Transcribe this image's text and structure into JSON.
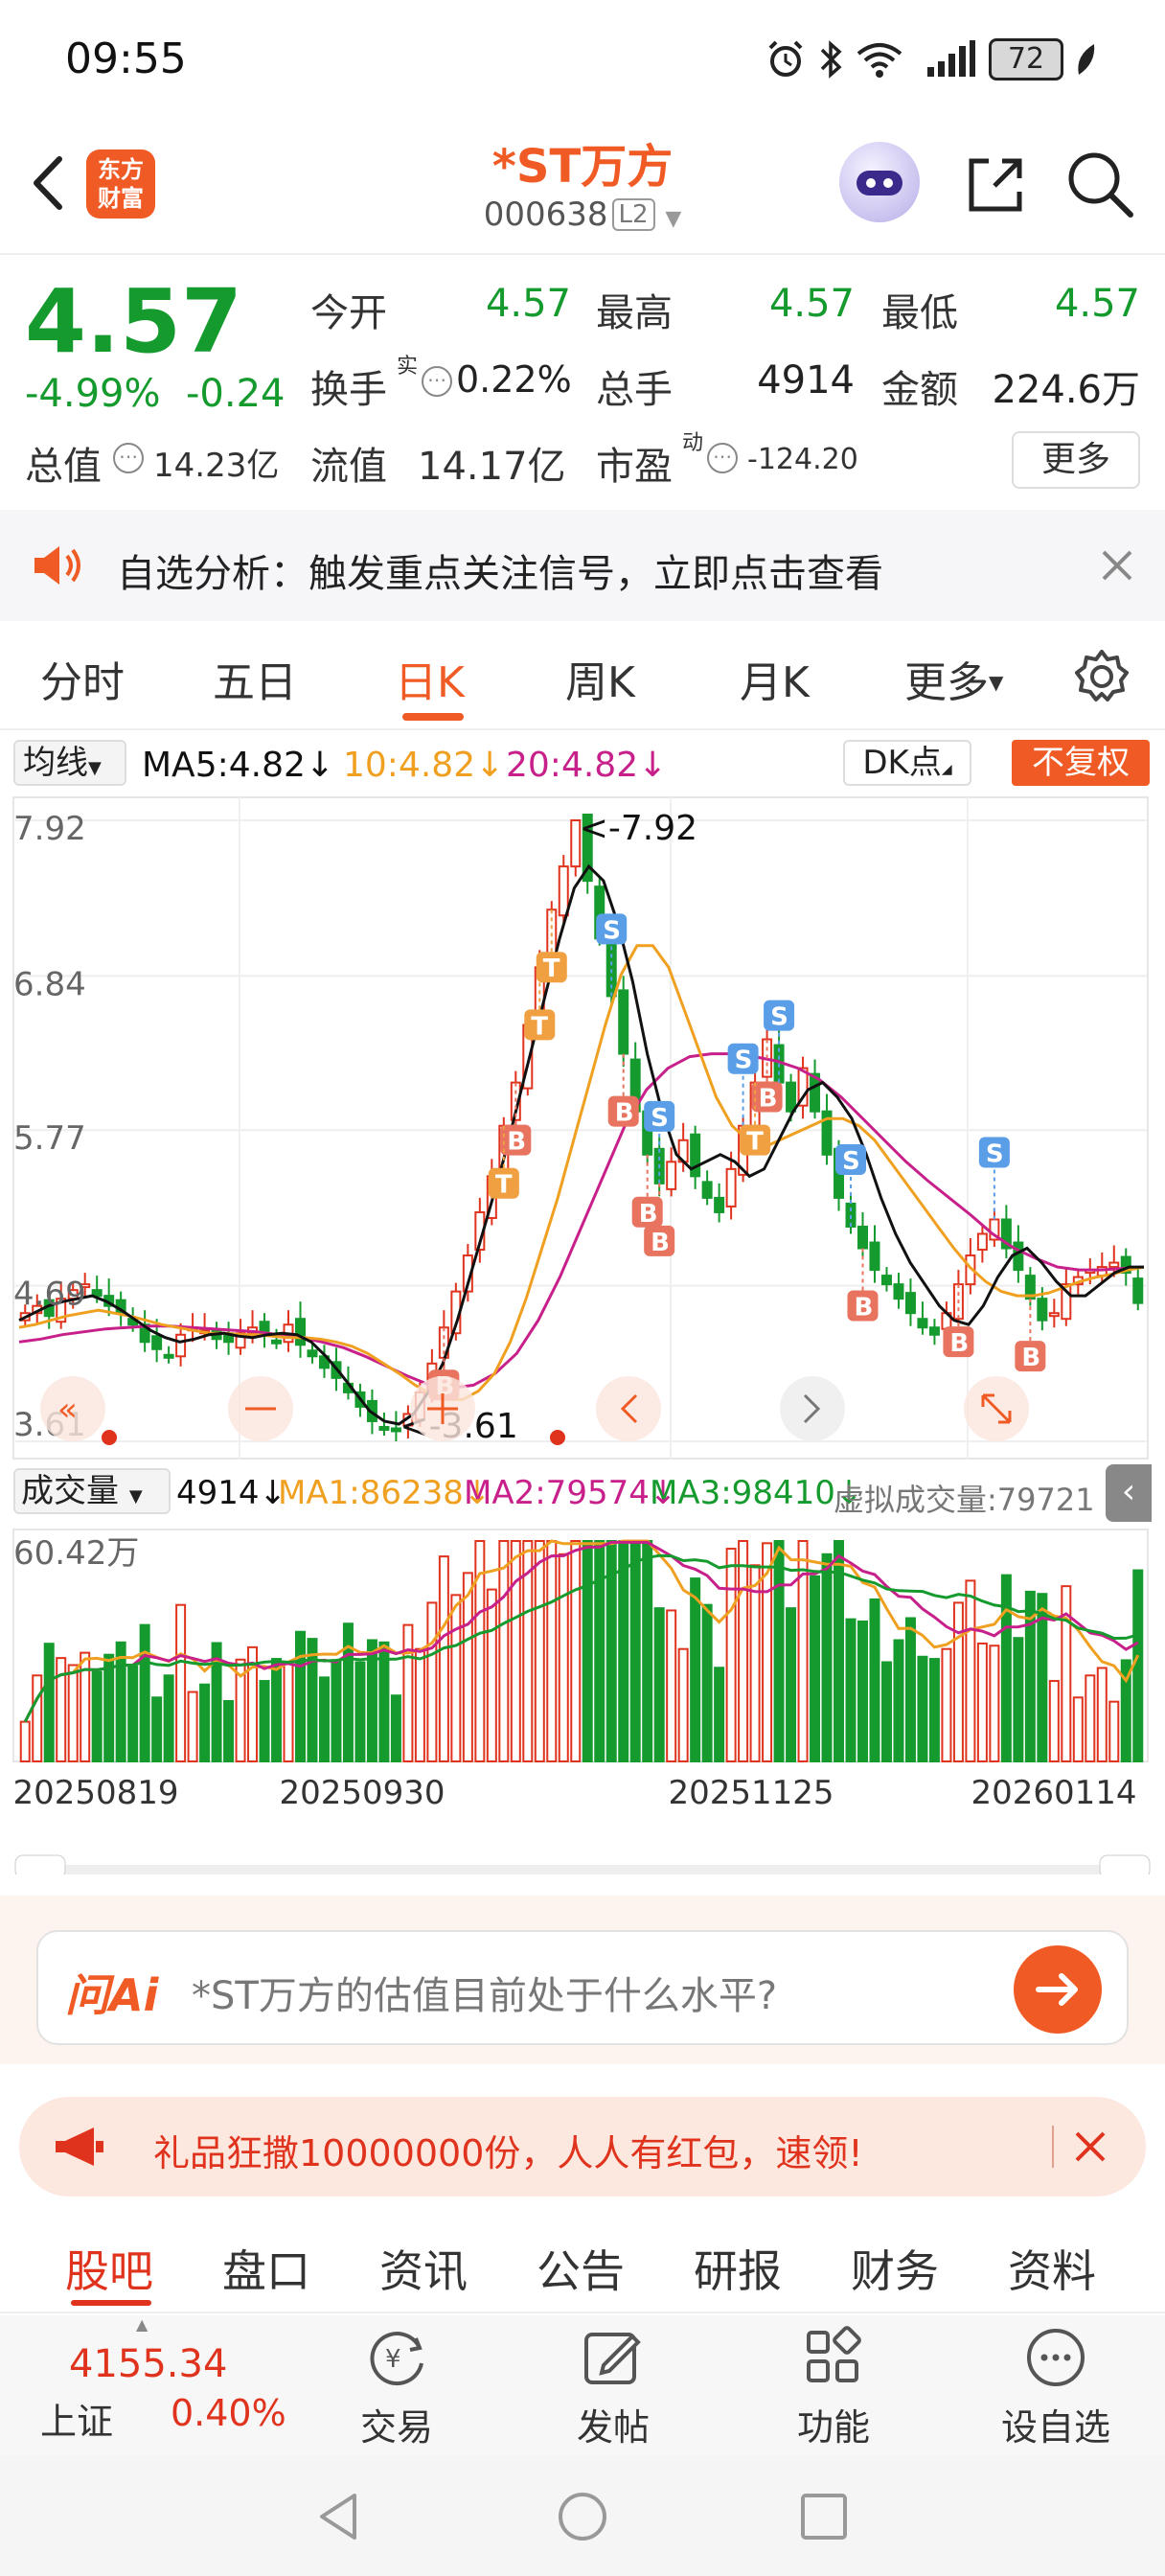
{
  "status_bar": {
    "time": "09:55",
    "battery": "72"
  },
  "header": {
    "logo_line1": "东方",
    "logo_line2": "财富",
    "stock_name": "*ST万方",
    "stock_code": "000638",
    "level_badge": "L2"
  },
  "quote": {
    "last_price": "4.57",
    "change_pct": "-4.99%",
    "change_val": "-0.24",
    "open_label": "今开",
    "open": "4.57",
    "high_label": "最高",
    "high": "4.57",
    "low_label": "最低",
    "low": "4.57",
    "turnover_label": "换手",
    "turnover_sup": "实",
    "turnover": "0.22%",
    "volume_label": "总手",
    "volume": "4914",
    "amount_label": "金额",
    "amount": "224.6万",
    "mktcap_label": "总值",
    "mktcap": "14.23亿",
    "float_label": "流值",
    "float_cap": "14.17亿",
    "pe_label": "市盈",
    "pe_sup": "动",
    "pe": "-124.20",
    "more_label": "更多"
  },
  "banner": {
    "text": "自选分析：触发重点关注信号，立即点击查看"
  },
  "period_tabs": [
    "分时",
    "五日",
    "日K",
    "周K",
    "月K",
    "更多"
  ],
  "active_tab": "日K",
  "ma_bar": {
    "selector": "均线",
    "ma5": "MA5:4.82",
    "ma10": "10:4.82",
    "ma20": "20:4.82",
    "dk_label": "DK点",
    "adjust_label": "不复权"
  },
  "colors": {
    "brand": "#f05a24",
    "up": "#e0331d",
    "down": "#159a2e",
    "ma5": "#111111",
    "ma10": "#f0a020",
    "ma20": "#c8208a"
  },
  "chart_data": {
    "type": "candlestick",
    "ylim": [
      3.61,
      7.92
    ],
    "y_ticks": [
      "7.92",
      "6.84",
      "5.77",
      "4.69",
      "3.61"
    ],
    "max_label": "<-7.92",
    "min_label": "<-3.61",
    "x_labels": [
      "20250819",
      "20250930",
      "20251125",
      "20260114"
    ],
    "candles_close": [
      4.5,
      4.55,
      4.48,
      4.6,
      4.66,
      4.7,
      4.62,
      4.55,
      4.5,
      4.42,
      4.3,
      4.25,
      4.2,
      4.35,
      4.4,
      4.38,
      4.32,
      4.3,
      4.36,
      4.4,
      4.35,
      4.3,
      4.42,
      4.28,
      4.2,
      4.12,
      4.05,
      3.95,
      3.85,
      3.75,
      3.7,
      3.68,
      3.8,
      3.95,
      4.15,
      4.4,
      4.65,
      4.9,
      5.2,
      5.45,
      5.8,
      6.1,
      6.5,
      6.9,
      7.3,
      7.6,
      7.92,
      7.5,
      7.1,
      6.7,
      6.3,
      5.9,
      5.6,
      5.4,
      5.55,
      5.7,
      5.45,
      5.3,
      5.2,
      5.5,
      5.8,
      6.1,
      6.4,
      6.1,
      5.9,
      6.2,
      5.9,
      5.6,
      5.3,
      5.1,
      4.95,
      4.8,
      4.7,
      4.6,
      4.5,
      4.4,
      4.35,
      4.5,
      4.7,
      4.9,
      5.05,
      5.15,
      4.95,
      4.8,
      4.6,
      4.45,
      4.5,
      4.7,
      4.75,
      4.8,
      4.82,
      4.85,
      4.78,
      4.57
    ],
    "ma5": [
      4.45,
      4.5,
      4.55,
      4.58,
      4.6,
      4.62,
      4.58,
      4.52,
      4.45,
      4.38,
      4.33,
      4.3,
      4.32,
      4.35,
      4.36,
      4.34,
      4.33,
      4.35,
      4.36,
      4.35,
      4.3,
      4.2,
      4.08,
      3.95,
      3.82,
      3.75,
      3.73,
      3.8,
      3.95,
      4.15,
      4.45,
      4.8,
      5.15,
      5.5,
      5.9,
      6.3,
      6.7,
      7.1,
      7.45,
      7.6,
      7.5,
      7.2,
      6.8,
      6.3,
      5.9,
      5.6,
      5.5,
      5.55,
      5.6,
      5.55,
      5.45,
      5.5,
      5.7,
      5.9,
      6.05,
      6.1,
      6.0,
      5.85,
      5.6,
      5.3,
      5.05,
      4.85,
      4.7,
      4.55,
      4.45,
      4.42,
      4.55,
      4.75,
      4.9,
      4.95,
      4.85,
      4.72,
      4.62,
      4.62,
      4.7,
      4.78,
      4.82,
      4.82
    ],
    "ma10": [
      4.4,
      4.42,
      4.45,
      4.48,
      4.5,
      4.52,
      4.5,
      4.48,
      4.45,
      4.42,
      4.4,
      4.38,
      4.36,
      4.36,
      4.35,
      4.35,
      4.34,
      4.33,
      4.33,
      4.32,
      4.3,
      4.27,
      4.22,
      4.15,
      4.08,
      4.0,
      3.94,
      3.9,
      3.9,
      3.96,
      4.08,
      4.3,
      4.6,
      4.95,
      5.3,
      5.7,
      6.1,
      6.5,
      6.85,
      7.05,
      7.05,
      6.9,
      6.6,
      6.3,
      6.0,
      5.8,
      5.7,
      5.65,
      5.7,
      5.75,
      5.8,
      5.85,
      5.85,
      5.8,
      5.7,
      5.55,
      5.4,
      5.25,
      5.1,
      4.95,
      4.82,
      4.72,
      4.65,
      4.62,
      4.62,
      4.64,
      4.68,
      4.72,
      4.75,
      4.77,
      4.8,
      4.82
    ],
    "ma20": [
      4.3,
      4.32,
      4.35,
      4.37,
      4.39,
      4.4,
      4.41,
      4.41,
      4.4,
      4.39,
      4.38,
      4.37,
      4.35,
      4.33,
      4.3,
      4.26,
      4.2,
      4.13,
      4.06,
      4.0,
      3.98,
      4.0,
      4.08,
      4.22,
      4.45,
      4.75,
      5.1,
      5.45,
      5.8,
      6.05,
      6.2,
      6.28,
      6.3,
      6.3,
      6.28,
      6.25,
      6.2,
      6.12,
      6.0,
      5.85,
      5.7,
      5.55,
      5.42,
      5.3,
      5.18,
      5.05,
      4.95,
      4.88,
      4.82,
      4.8,
      4.8,
      4.81,
      4.82
    ],
    "signals_buy": 9,
    "signals_sell": 6,
    "signals_t": 4
  },
  "volume_bar": {
    "selector": "成交量",
    "vol": "4914",
    "ma1": "MA1:86238",
    "ma2": "MA2:79574",
    "ma3": "MA3:98410",
    "virtual": "虚拟成交量:79721",
    "max_label": "60.42万"
  },
  "ai": {
    "logo": "问Ai",
    "placeholder": "*ST万方的估值目前处于什么水平?"
  },
  "promo": {
    "text": "礼品狂撒10000000份，人人有红包，速领!"
  },
  "bottom_tabs": [
    "股吧",
    "盘口",
    "资讯",
    "公告",
    "研报",
    "财务",
    "资料"
  ],
  "dock": {
    "index_value": "4155.34",
    "index_name": "上证",
    "index_change": "0.40%",
    "trade": "交易",
    "post": "发帖",
    "features": "功能",
    "watchlist": "设自选"
  }
}
